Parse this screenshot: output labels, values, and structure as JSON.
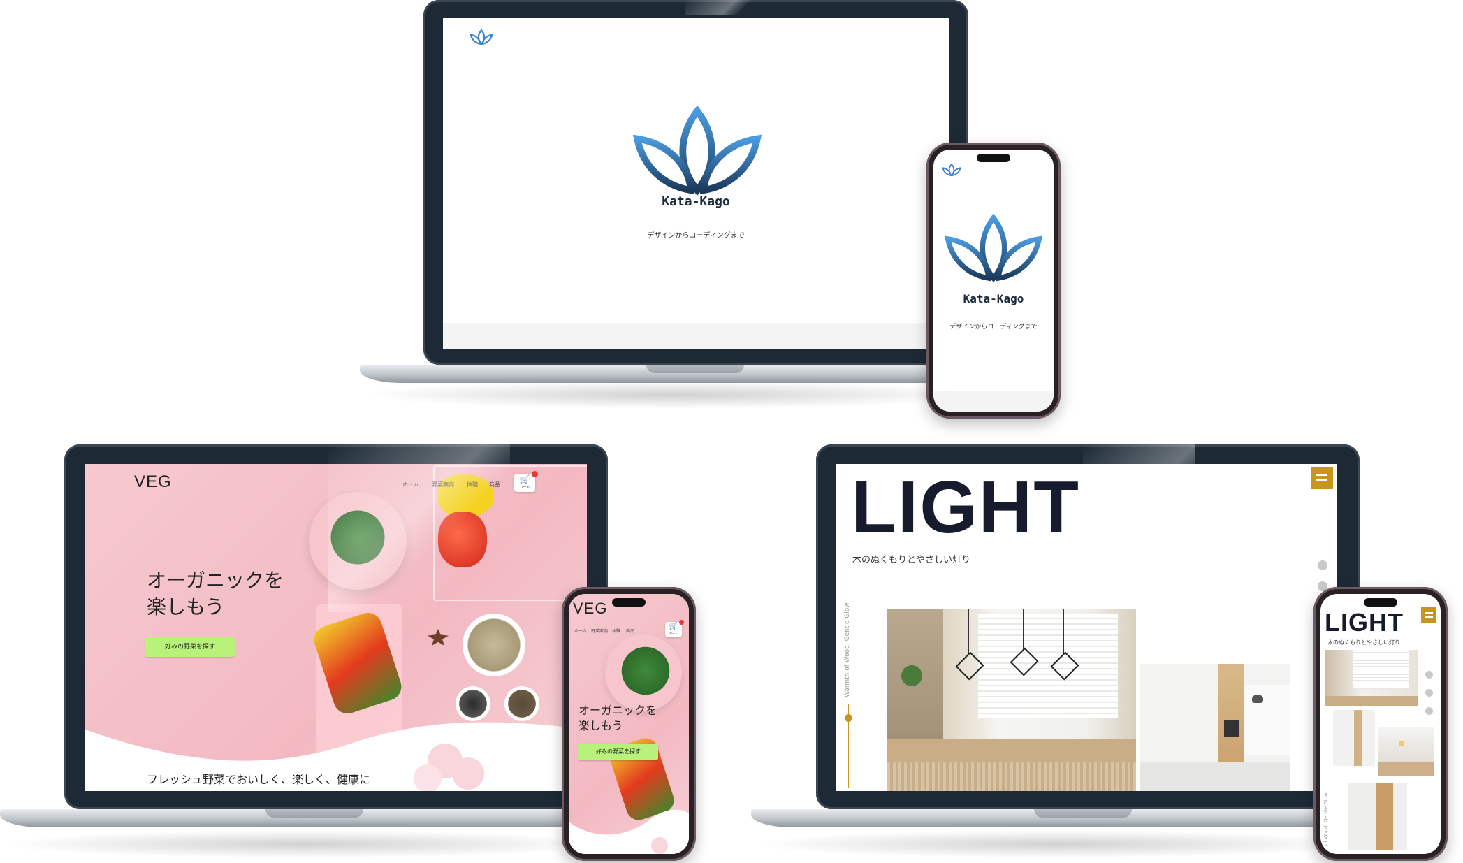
{
  "kata_kago": {
    "brand": "Kata-Kago",
    "tagline": "デザインからコーディングまで"
  },
  "veg": {
    "logo": "VEG",
    "nav": [
      "ホーム",
      "野菜案内",
      "体験",
      "商品"
    ],
    "cart_label": "カート",
    "hero_line1": "オーガニックを",
    "hero_line2": "楽しもう",
    "button_label": "好みの野菜を探す",
    "tagline": "フレッシュ野菜でおいしく、楽しく、健康に"
  },
  "light": {
    "title": "LIGHT",
    "subtitle": "木のぬくもりとやさしい灯り",
    "vertical_text": "Warmth of Wood, Gentle Glow",
    "vertical_text_phone": "of Wood, Gentle Glow"
  },
  "colors": {
    "leaf_blue": "#3b82c9",
    "leaf_dark": "#1b3a5c",
    "veg_pink": "#f3b9c2",
    "veg_button": "#b9f27a",
    "light_gold": "#c8961e",
    "light_navy": "#161b2e",
    "device_frame": "#1d2a36"
  },
  "icons": [
    "lotus-logo-icon",
    "cart-icon",
    "menu-icon",
    "twitter-icon",
    "facebook-icon",
    "instagram-icon"
  ]
}
